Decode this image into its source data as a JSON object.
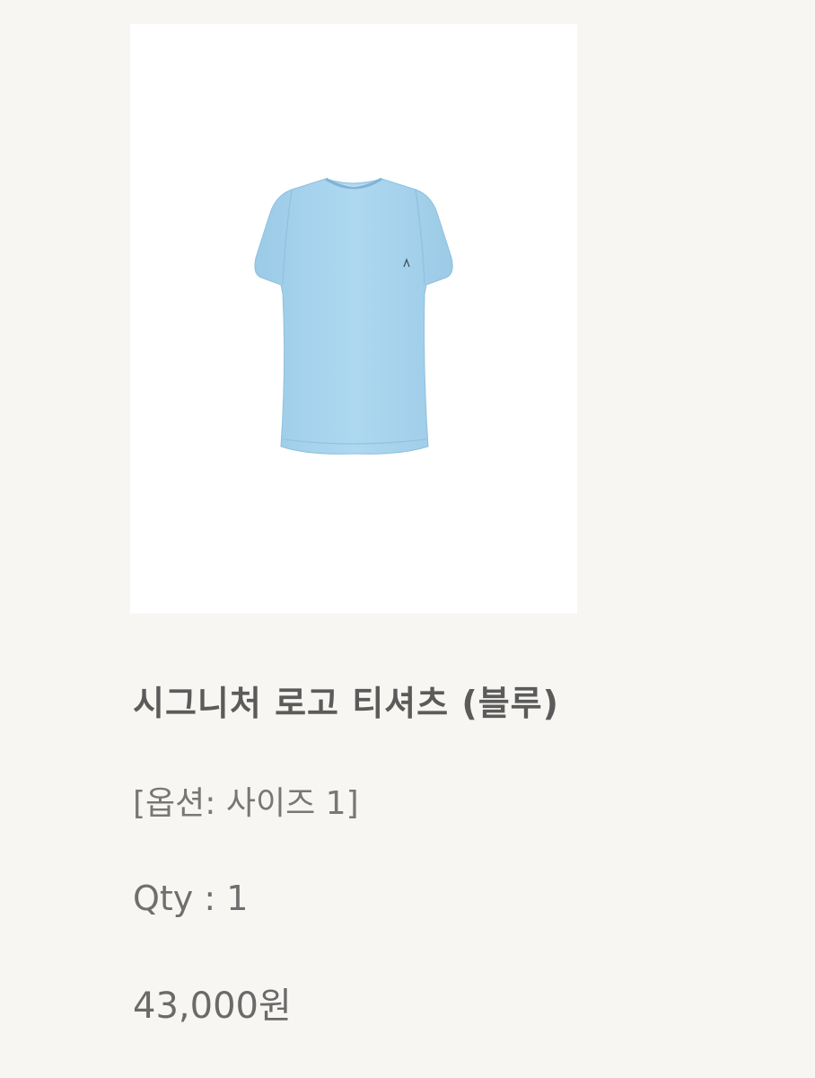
{
  "product": {
    "image_icon": "t-shirt-icon",
    "shirt_color": "#a9d4ee",
    "title": "시그니처 로고 티셔츠 (블루)",
    "option": "[옵션: 사이즈 1]",
    "qty": "Qty : 1",
    "price": "43,000원"
  },
  "colors": {
    "background": "#f7f6f2",
    "cutoff_accent": "#d8a347"
  }
}
